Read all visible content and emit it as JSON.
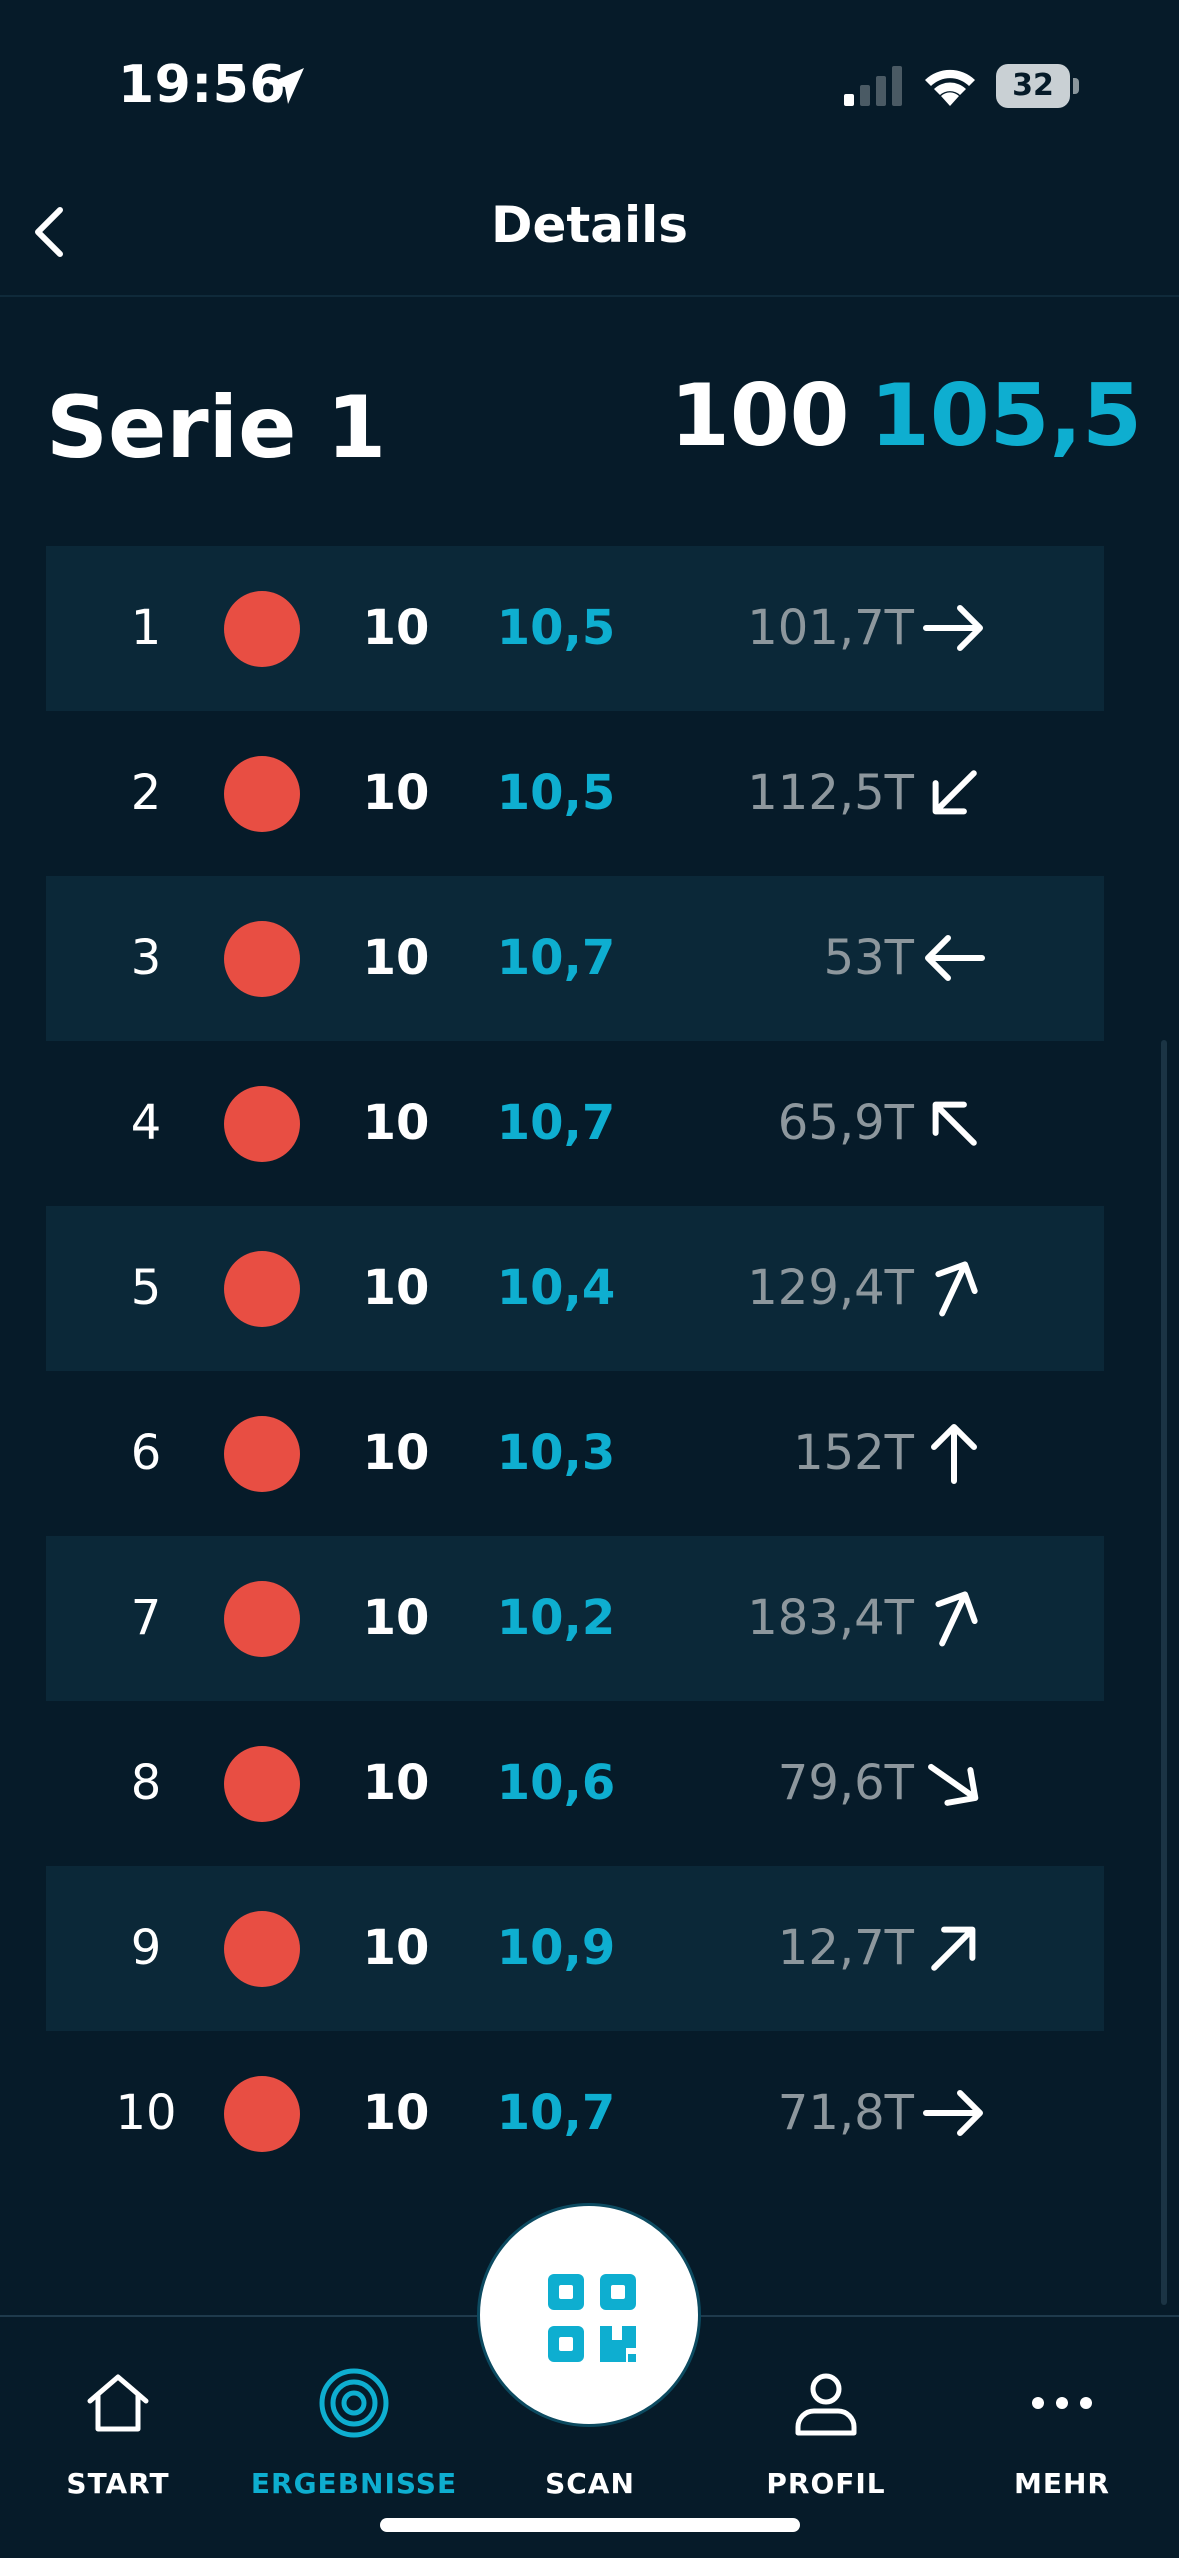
{
  "status_bar": {
    "time": "19:56",
    "battery": "32"
  },
  "header": {
    "title": "Details"
  },
  "series": {
    "title": "Serie 1",
    "total": "100",
    "total_decimal": "105,5"
  },
  "shots": [
    {
      "num": "1",
      "ring": "10",
      "decimal": "10,5",
      "teiler": "101,7T",
      "direction": "right"
    },
    {
      "num": "2",
      "ring": "10",
      "decimal": "10,5",
      "teiler": "112,5T",
      "direction": "down-left"
    },
    {
      "num": "3",
      "ring": "10",
      "decimal": "10,7",
      "teiler": "53T",
      "direction": "left"
    },
    {
      "num": "4",
      "ring": "10",
      "decimal": "10,7",
      "teiler": "65,9T",
      "direction": "up-left"
    },
    {
      "num": "5",
      "ring": "10",
      "decimal": "10,4",
      "teiler": "129,4T",
      "direction": "up-right-steep"
    },
    {
      "num": "6",
      "ring": "10",
      "decimal": "10,3",
      "teiler": "152T",
      "direction": "up"
    },
    {
      "num": "7",
      "ring": "10",
      "decimal": "10,2",
      "teiler": "183,4T",
      "direction": "up-right-steep"
    },
    {
      "num": "8",
      "ring": "10",
      "decimal": "10,6",
      "teiler": "79,6T",
      "direction": "down-right"
    },
    {
      "num": "9",
      "ring": "10",
      "decimal": "10,9",
      "teiler": "12,7T",
      "direction": "up-right"
    },
    {
      "num": "10",
      "ring": "10",
      "decimal": "10,7",
      "teiler": "71,8T",
      "direction": "right"
    }
  ],
  "tab_bar": {
    "start": "START",
    "results": "ERGEBNISSE",
    "scan": "SCAN",
    "profile": "PROFIL",
    "more": "MEHR"
  },
  "colors": {
    "background": "#061b29",
    "row_alt": "#0b2838",
    "accent": "#0eaed0",
    "hit_dot": "#e84e43",
    "muted": "#8d979d"
  }
}
